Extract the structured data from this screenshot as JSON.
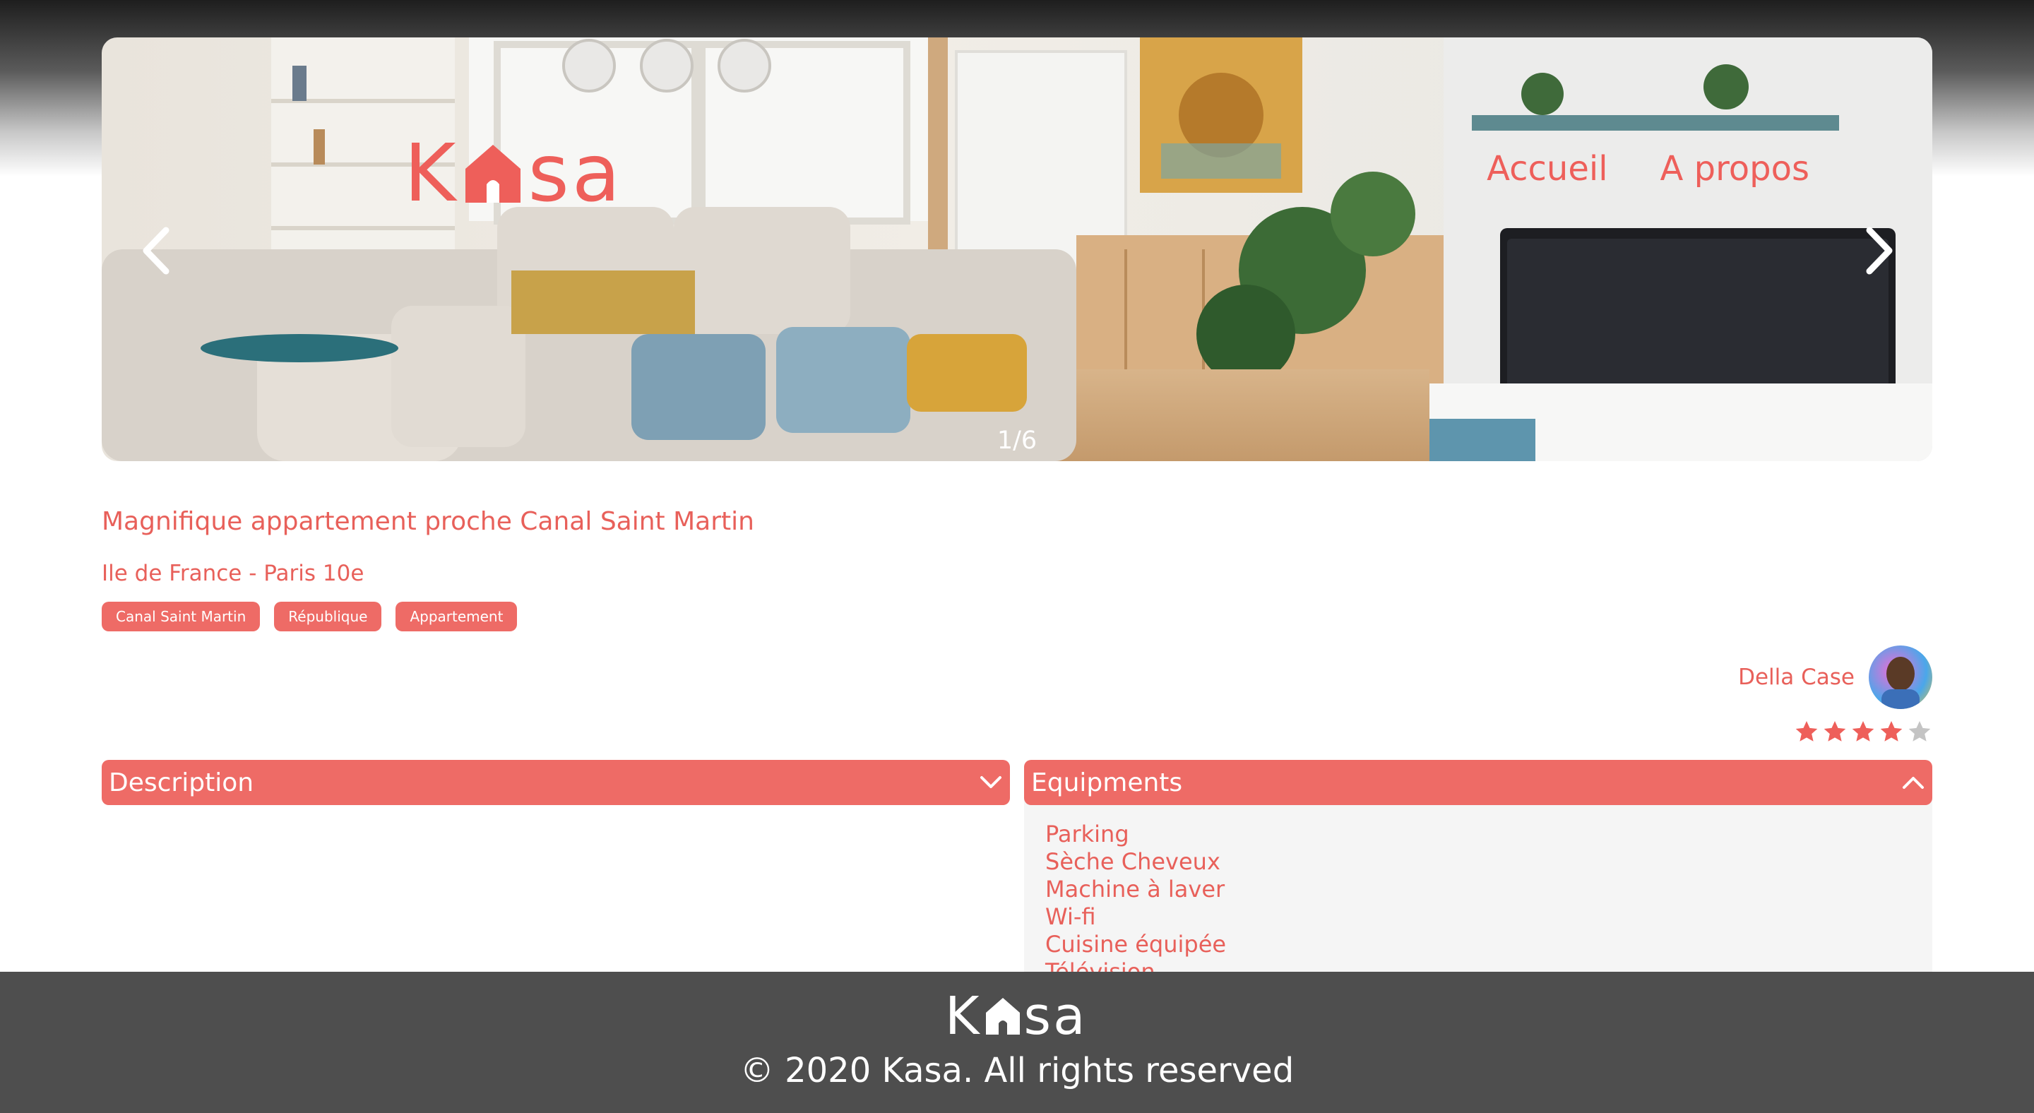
{
  "brand": {
    "logo_prefix": "K",
    "logo_suffix": "sa",
    "name": "Kasa",
    "accent_color": "#EE5F5A"
  },
  "nav": {
    "items": [
      {
        "label": "Accueil"
      },
      {
        "label": "A propos"
      }
    ]
  },
  "carousel": {
    "counter": "1/6",
    "prev_icon": "chevron-left-icon",
    "next_icon": "chevron-right-icon"
  },
  "listing": {
    "title": "Magnifique appartement proche Canal Saint Martin",
    "location": "Ile de France - Paris 10e",
    "tags": [
      "Canal Saint Martin",
      "République",
      "Appartement"
    ],
    "host": {
      "name": "Della Case"
    },
    "rating": {
      "value": 4,
      "max": 5
    }
  },
  "collapses": {
    "description": {
      "label": "Description",
      "state": "collapsed",
      "icon": "chevron-down-icon"
    },
    "equipments": {
      "label": "Equipments",
      "state": "expanded",
      "icon": "chevron-up-icon",
      "items": [
        "Parking",
        "Sèche Cheveux",
        "Machine à laver",
        "Wi-fi",
        "Cuisine équipée",
        "Télévision"
      ]
    }
  },
  "footer": {
    "logo_prefix": "K",
    "logo_suffix": "sa",
    "copyright": "© 2020 Kasa. All rights reserved"
  }
}
